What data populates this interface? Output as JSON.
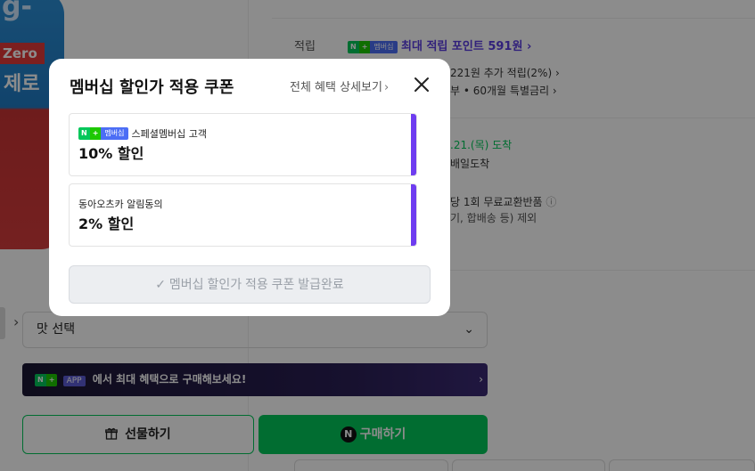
{
  "background": {
    "product_image": {
      "logo_text": "g-",
      "zero_text": "Zero",
      "jero_text": "제로"
    },
    "rows": {
      "point_label": "적립",
      "point_badge": {
        "n": "N",
        "plus": "+",
        "mb": "멤버십"
      },
      "point_text": "최대 적립 포인트 591원",
      "point_chevron": "›",
      "extra_point": "221원 추가 적립(2%)",
      "extra_point_chevron": "›",
      "installment": "부 • 60개월 특별금리",
      "installment_chevron": "›",
      "delivery_date": ".21.(목) 도착",
      "delivery_next": "배일도착",
      "exchange": "당 1회 무료교환반품",
      "exchange_info_icon": "ⓘ",
      "exclude": "기, 합배송 등) 제외"
    },
    "select": {
      "value": "맛 선택",
      "chevron": "⌄"
    },
    "promo": {
      "n": "N",
      "plus": "+",
      "app": "APP",
      "text": "에서 최대 혜택으로 구매해보세요!",
      "chevron": "›"
    },
    "gift_button": {
      "label": "선물하기",
      "icon": "gift-icon"
    },
    "buy_button": {
      "label": "구매하기",
      "icon_text": "N"
    },
    "thumb_next": "›"
  },
  "modal": {
    "title": "멤버십 할인가 적용 쿠폰",
    "detail_link": "전체 혜택 상세보기",
    "detail_link_arrow": "›",
    "close_icon": "close-icon",
    "coupons": [
      {
        "badge": {
          "n": "N",
          "plus": "+",
          "mb": "멤버십"
        },
        "sub": "스페셜멤버십 고객",
        "discount": "10% 할인"
      },
      {
        "sub": "동아오츠카 알림동의",
        "discount": "2% 할인"
      }
    ],
    "issued_button": {
      "check": "✓",
      "label": "멤버십 할인가 적용 쿠폰 발급완료"
    },
    "accent_color": "#6e3cf0"
  }
}
